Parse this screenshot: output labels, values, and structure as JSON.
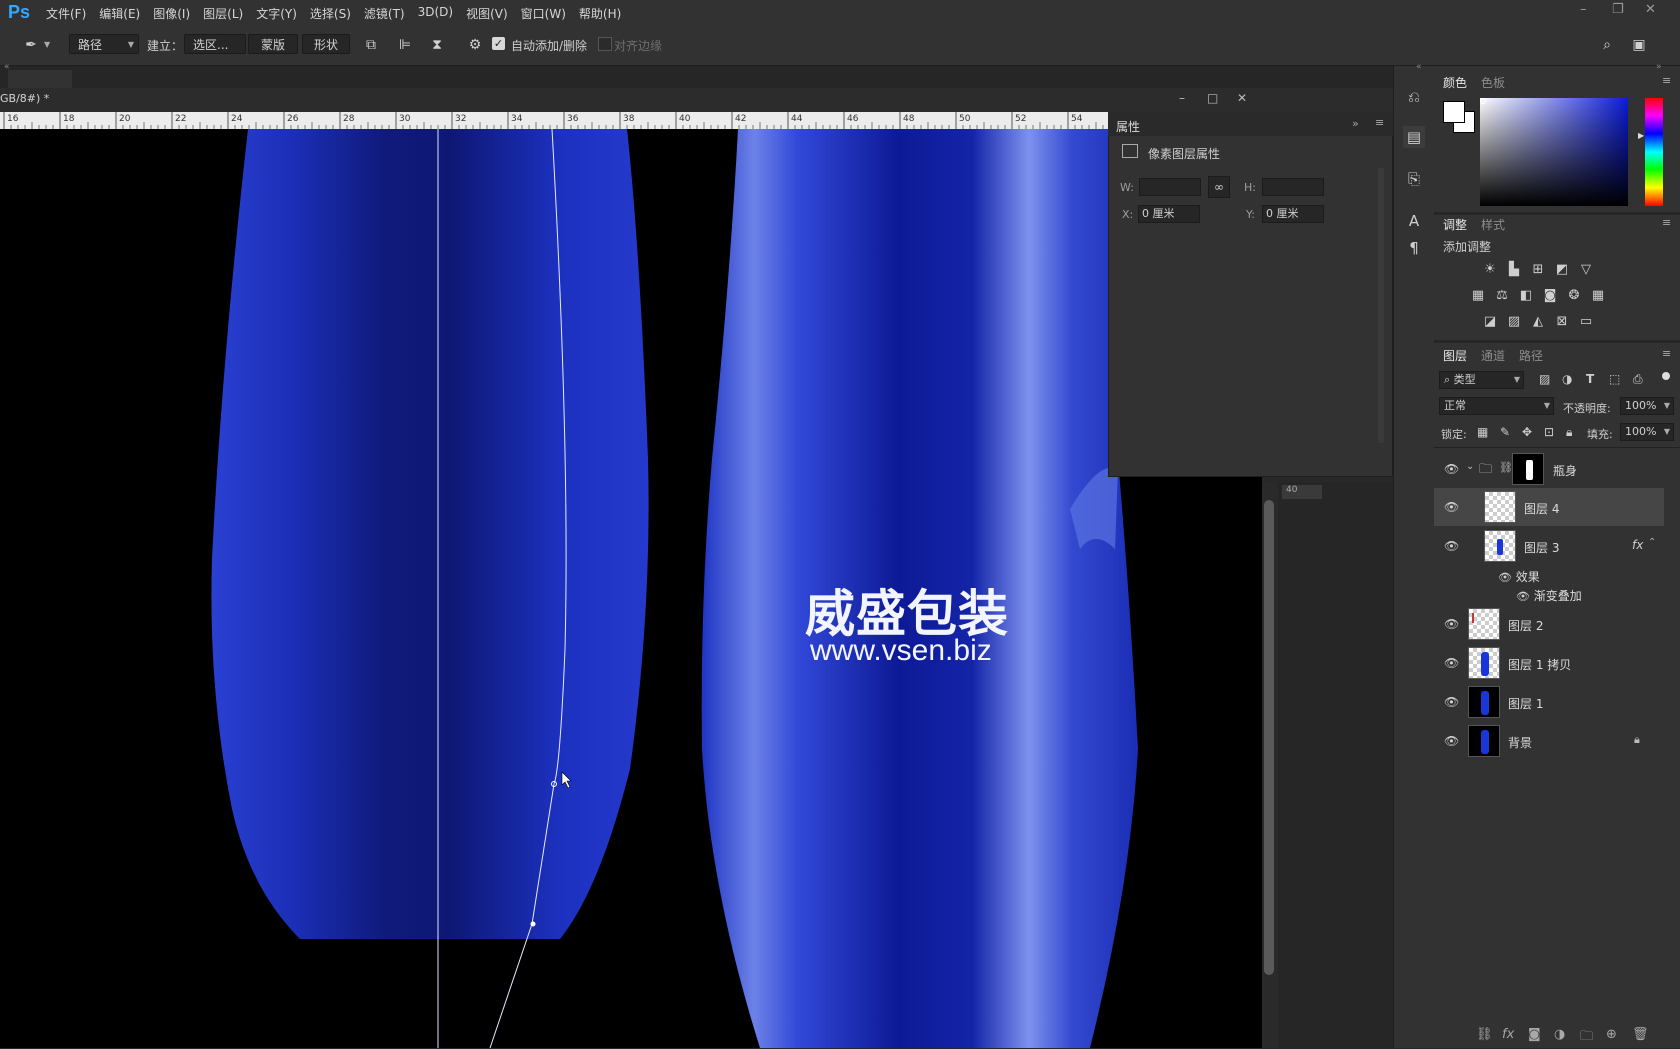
{
  "app": {
    "logo": "Ps"
  },
  "menu": [
    "文件(F)",
    "编辑(E)",
    "图像(I)",
    "图层(L)",
    "文字(Y)",
    "选择(S)",
    "滤镜(T)",
    "3D(D)",
    "视图(V)",
    "窗口(W)",
    "帮助(H)"
  ],
  "window_controls": [
    "–",
    "❐",
    "✕"
  ],
  "options": {
    "tool_icon": "pen-tool-icon",
    "mode": "路径",
    "make_label": "建立：",
    "selection": "选区...",
    "mask": "蒙版",
    "shape": "形状",
    "auto_add_delete": "自动添加/删除",
    "auto_add_delete_checked": true,
    "align_edges": "对齐边缘"
  },
  "document": {
    "title": "GB/8#) *",
    "ruler_ticks": [
      "16",
      "18",
      "20",
      "22",
      "24",
      "26",
      "28",
      "30",
      "32",
      "34",
      "36",
      "38",
      "40",
      "42",
      "44",
      "46",
      "48",
      "50",
      "52",
      "54"
    ],
    "mini_ruler": "40",
    "watermark_line1": "威盛包装",
    "watermark_line2": "www.vsen.biz"
  },
  "properties": {
    "tab": "属性",
    "subtitle": "像素图层属性",
    "w_label": "W:",
    "h_label": "H:",
    "x_label": "X:",
    "x_value": "0 厘米",
    "y_label": "Y:",
    "y_value": "0 厘米"
  },
  "color_panel": {
    "tabs": [
      "颜色",
      "色板"
    ],
    "foreground": "#ffffff",
    "background": "#ffffff"
  },
  "adjust_panel": {
    "tabs": [
      "调整",
      "样式"
    ],
    "add_label": "添加调整"
  },
  "layers_panel": {
    "tabs": [
      "图层",
      "通道",
      "路径"
    ],
    "filter": "类型",
    "blend_mode": "正常",
    "opacity_label": "不透明度:",
    "opacity": "100%",
    "lock_label": "锁定:",
    "fill_label": "填充:",
    "fill": "100%",
    "group_name": "瓶身",
    "layers": [
      {
        "name": "图层 4"
      },
      {
        "name": "图层 3",
        "fx": "fx"
      },
      {
        "name": "图层 2"
      },
      {
        "name": "图层 1 拷贝"
      },
      {
        "name": "图层 1"
      },
      {
        "name": "背景"
      }
    ],
    "effects_label": "效果",
    "effect_name": "渐变叠加"
  }
}
